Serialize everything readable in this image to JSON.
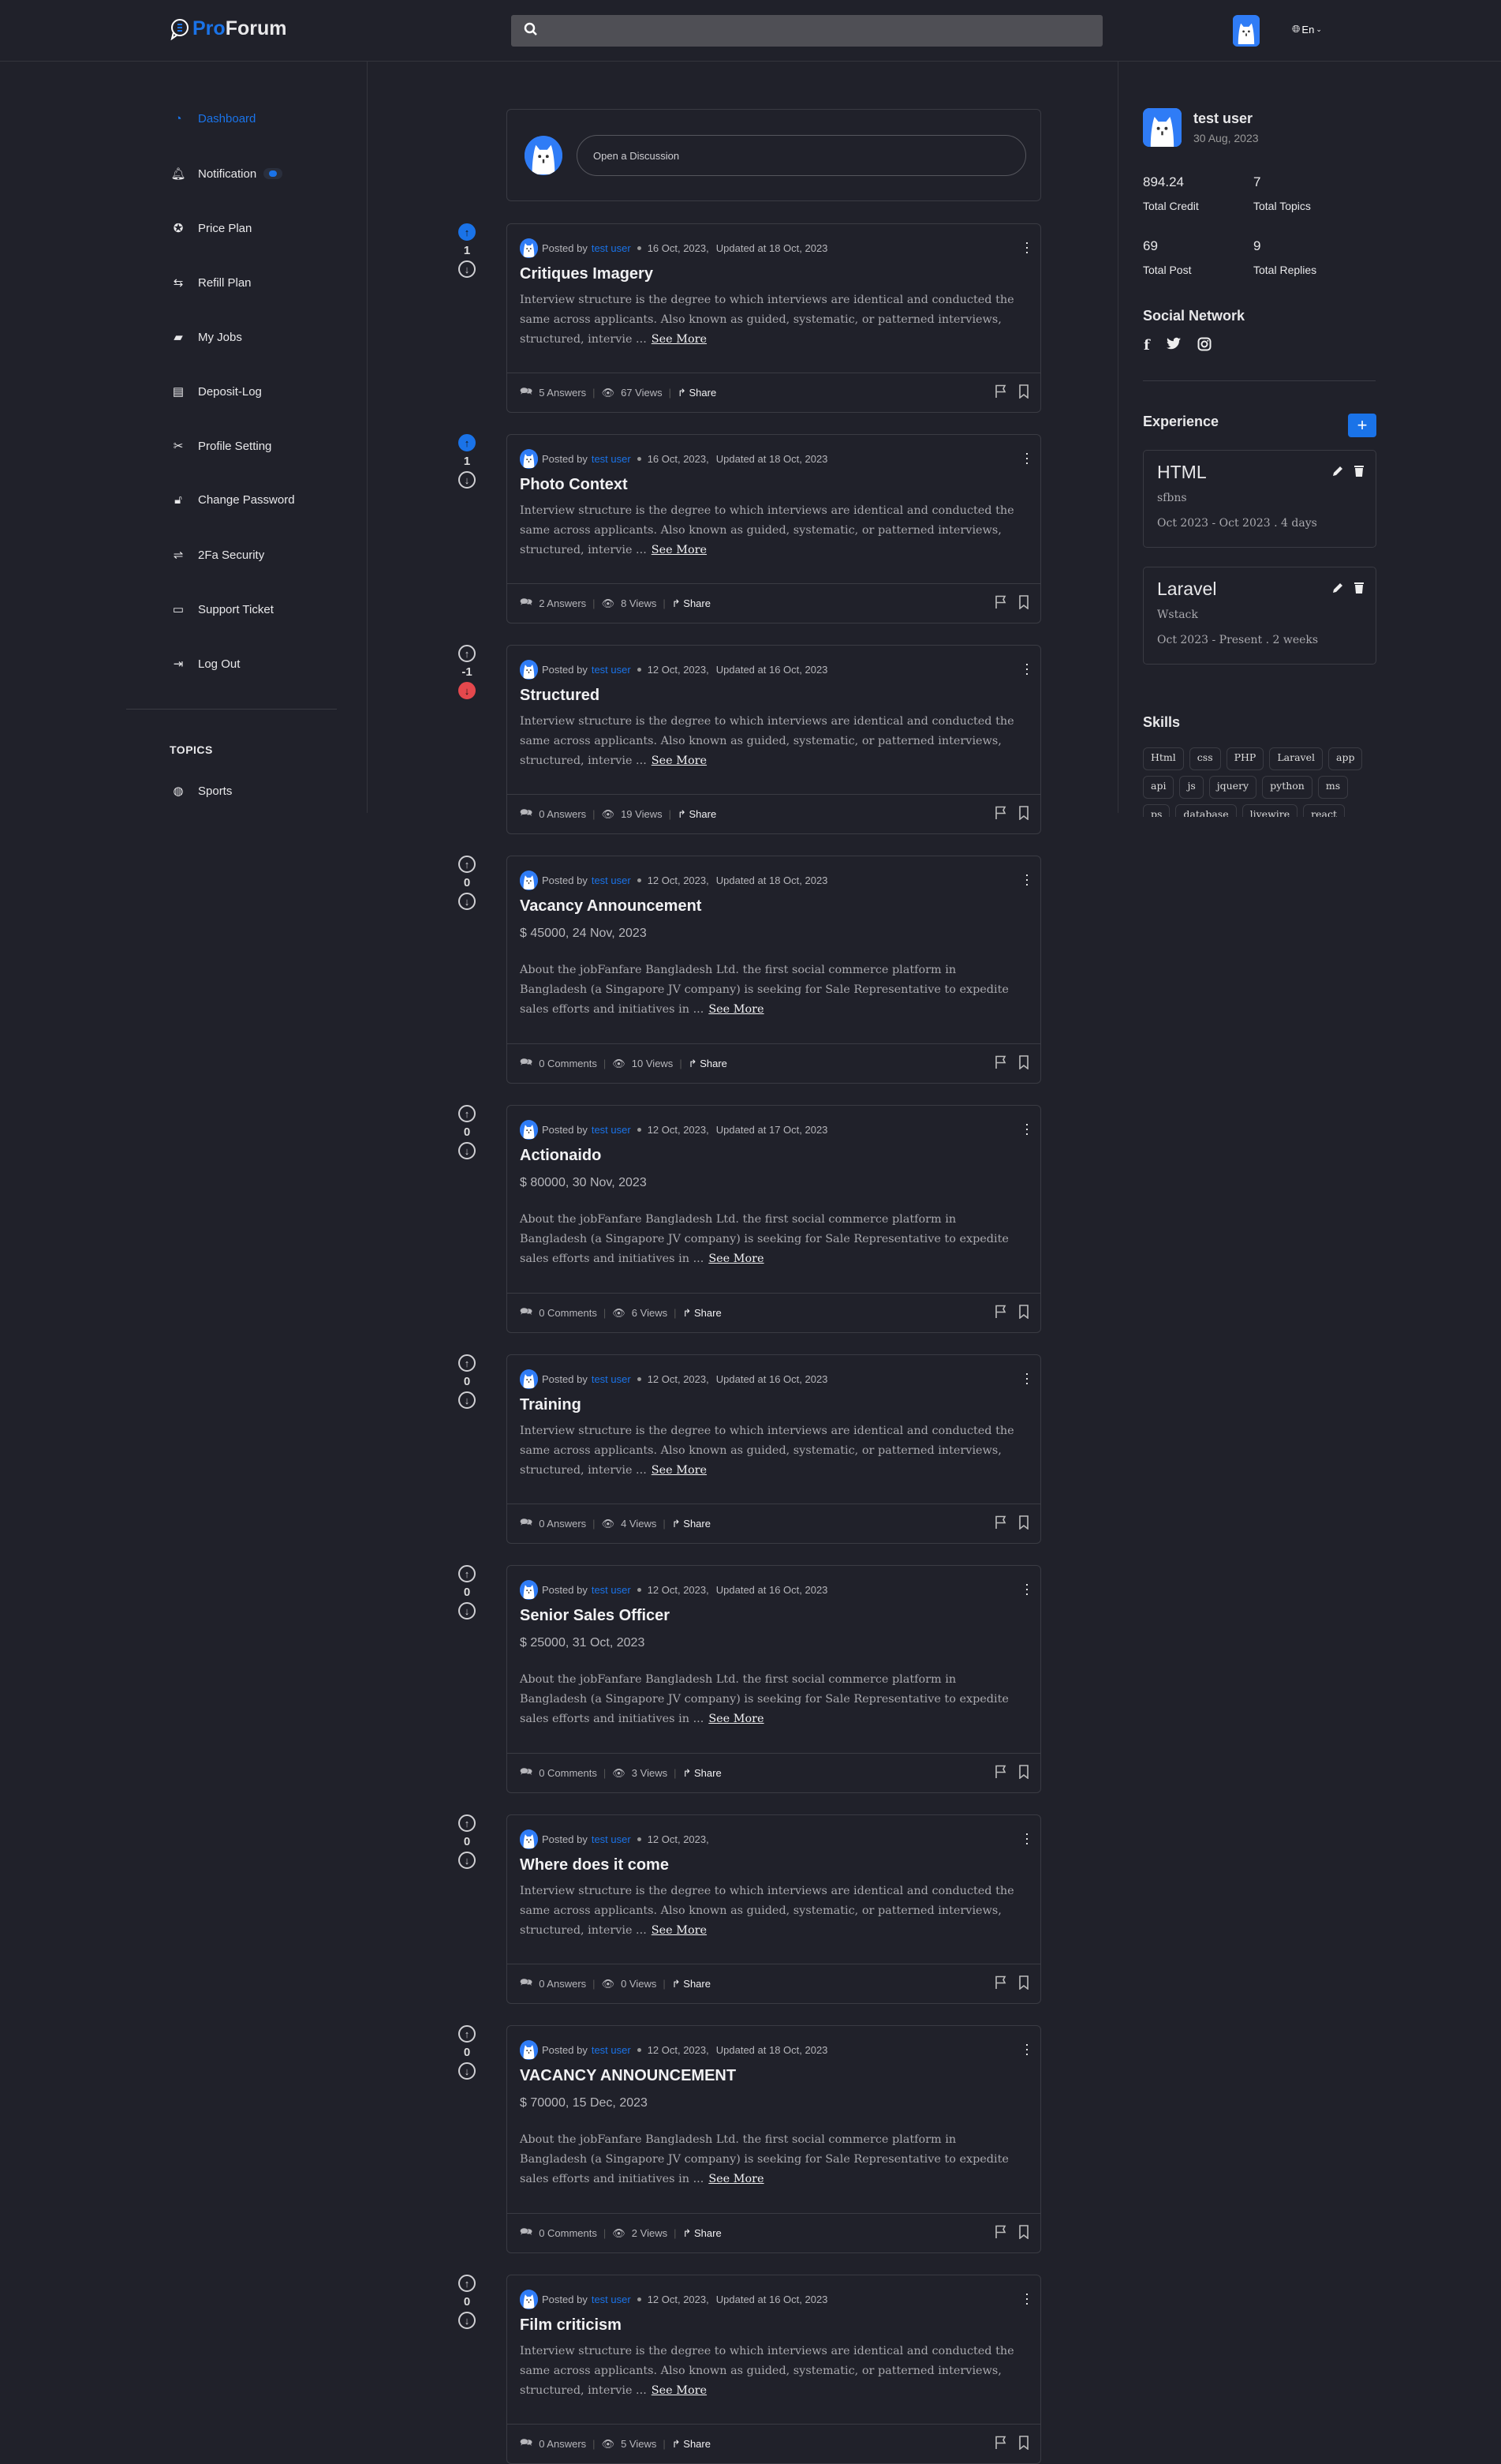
{
  "header": {
    "logo_pro": "Pro",
    "logo_forum": "Forum",
    "search_placeholder": "",
    "lang": "En"
  },
  "sidebar": {
    "items": [
      {
        "label": "Dashboard",
        "icon": "dashboard-icon",
        "active": true
      },
      {
        "label": "Notification",
        "icon": "bell-icon",
        "badge": true
      },
      {
        "label": "Price Plan",
        "icon": "award-icon"
      },
      {
        "label": "Refill Plan",
        "icon": "retweet-icon"
      },
      {
        "label": "My Jobs",
        "icon": "briefcase-icon"
      },
      {
        "label": "Deposit-Log",
        "icon": "receipt-icon"
      },
      {
        "label": "Profile Setting",
        "icon": "tools-icon"
      },
      {
        "label": "Change Password",
        "icon": "unlock-icon"
      },
      {
        "label": "2Fa Security",
        "icon": "signpost-icon"
      },
      {
        "label": "Support Ticket",
        "icon": "ticket-icon"
      },
      {
        "label": "Log Out",
        "icon": "logout-icon"
      }
    ],
    "topics_heading": "TOPICS",
    "topics": [
      {
        "label": "Sports",
        "icon": "basketball-icon"
      }
    ]
  },
  "composer": {
    "placeholder": "Open a Discussion"
  },
  "posts": [
    {
      "votes": "1",
      "vote_state": "up",
      "author": "test user",
      "posted": "16 Oct, 2023,",
      "updated": "Updated at 18 Oct, 2023",
      "title": "Critiques Imagery",
      "body": "Interview structure is the degree to which interviews are identical and conducted the same across applicants. Also known as guided, systematic, or patterned interviews, structured, intervie ...",
      "count": "5 Answers",
      "views": "67 Views"
    },
    {
      "votes": "1",
      "vote_state": "up",
      "author": "test user",
      "posted": "16 Oct, 2023,",
      "updated": "Updated at 18 Oct, 2023",
      "title": "Photo Context",
      "body": "Interview structure is the degree to which interviews are identical and conducted the same across applicants. Also known as guided, systematic, or patterned interviews, structured, intervie ...",
      "count": "2 Answers",
      "views": "8 Views"
    },
    {
      "votes": "-1",
      "vote_state": "down",
      "author": "test user",
      "posted": "12 Oct, 2023,",
      "updated": "Updated at 16 Oct, 2023",
      "title": "Structured",
      "body": "Interview structure is the degree to which interviews are identical and conducted the same across applicants. Also known as guided, systematic, or patterned interviews, structured, intervie ...",
      "count": "0 Answers",
      "views": "19 Views"
    },
    {
      "votes": "0",
      "vote_state": "none",
      "author": "test user",
      "posted": "12 Oct, 2023,",
      "updated": "Updated at 18 Oct, 2023",
      "title": "Vacancy Announcement",
      "salary": "$ 45000,  24 Nov, 2023",
      "body": "About the jobFanfare Bangladesh Ltd. the first social commerce platform in Bangladesh (a Singapore JV company) is seeking for Sale Representative to expedite sales efforts and initiatives in ...",
      "count": "0 Comments",
      "views": "10 Views"
    },
    {
      "votes": "0",
      "vote_state": "none",
      "author": "test user",
      "posted": "12 Oct, 2023,",
      "updated": "Updated at 17 Oct, 2023",
      "title": "Actionaido",
      "salary": "$ 80000,  30 Nov, 2023",
      "body": "About the jobFanfare Bangladesh Ltd. the first social commerce platform in Bangladesh (a Singapore JV company) is seeking for Sale Representative to expedite sales efforts and initiatives in ...",
      "count": "0 Comments",
      "views": "6 Views"
    },
    {
      "votes": "0",
      "vote_state": "none",
      "author": "test user",
      "posted": "12 Oct, 2023,",
      "updated": "Updated at 16 Oct, 2023",
      "title": "Training",
      "body": "Interview structure is the degree to which interviews are identical and conducted the same across applicants. Also known as guided, systematic, or patterned interviews, structured, intervie ...",
      "count": "0 Answers",
      "views": "4 Views"
    },
    {
      "votes": "0",
      "vote_state": "none",
      "author": "test user",
      "posted": "12 Oct, 2023,",
      "updated": "Updated at 16 Oct, 2023",
      "title": "Senior Sales Officer",
      "salary": "$ 25000,  31 Oct, 2023",
      "body": "About the jobFanfare Bangladesh Ltd. the first social commerce platform in Bangladesh (a Singapore JV company) is seeking for Sale Representative to expedite sales efforts and initiatives in ...",
      "count": "0 Comments",
      "views": "3 Views"
    },
    {
      "votes": "0",
      "vote_state": "none",
      "author": "test user",
      "posted": "12 Oct, 2023,",
      "updated": "",
      "title": "Where does it come",
      "body": "Interview structure is the degree to which interviews are identical and conducted the same across applicants. Also known as guided, systematic, or patterned interviews, structured, intervie ...",
      "count": "0 Answers",
      "views": "0 Views"
    },
    {
      "votes": "0",
      "vote_state": "none",
      "author": "test user",
      "posted": "12 Oct, 2023,",
      "updated": "Updated at 18 Oct, 2023",
      "title": "VACANCY ANNOUNCEMENT",
      "salary": "$ 70000,  15 Dec, 2023",
      "body": "About the jobFanfare Bangladesh Ltd. the first social commerce platform in Bangladesh (a Singapore JV company) is seeking for Sale Representative to expedite sales efforts and initiatives in ...",
      "count": "0 Comments",
      "views": "2 Views"
    },
    {
      "votes": "0",
      "vote_state": "none",
      "author": "test user",
      "posted": "12 Oct, 2023,",
      "updated": "Updated at 16 Oct, 2023",
      "title": "Film criticism",
      "body": "Interview structure is the degree to which interviews are identical and conducted the same across applicants. Also known as guided, systematic, or patterned interviews, structured, intervie ...",
      "count": "0 Answers",
      "views": "5 Views"
    }
  ],
  "post_labels": {
    "posted_by": "Posted by",
    "see_more": "See More",
    "share": "Share"
  },
  "profile": {
    "name": "test user",
    "joined": "30 Aug, 2023",
    "stats": [
      {
        "value": "894.24",
        "label": "Total Credit"
      },
      {
        "value": "7",
        "label": "Total Topics"
      },
      {
        "value": "69",
        "label": "Total Post"
      },
      {
        "value": "9",
        "label": "Total Replies"
      }
    ],
    "social_heading": "Social Network",
    "social": [
      "facebook-icon",
      "twitter-icon",
      "instagram-icon"
    ]
  },
  "experience": {
    "heading": "Experience",
    "add_label": "+",
    "items": [
      {
        "title": "HTML",
        "company": "sfbns",
        "dates": "Oct 2023 - Oct 2023 . 4 days"
      },
      {
        "title": "Laravel",
        "company": "Wstack",
        "dates": "Oct 2023 - Present . 2 weeks"
      }
    ]
  },
  "skills": {
    "heading": "Skills",
    "items": [
      "Html",
      "css",
      "PHP",
      "Laravel",
      "app",
      "api",
      "js",
      "jquery",
      "python",
      "ms",
      "ps",
      "database",
      "livewire",
      "react"
    ]
  },
  "colors": {
    "accent": "#1a73e8",
    "downvote": "#e5484d",
    "background": "#20212a"
  }
}
